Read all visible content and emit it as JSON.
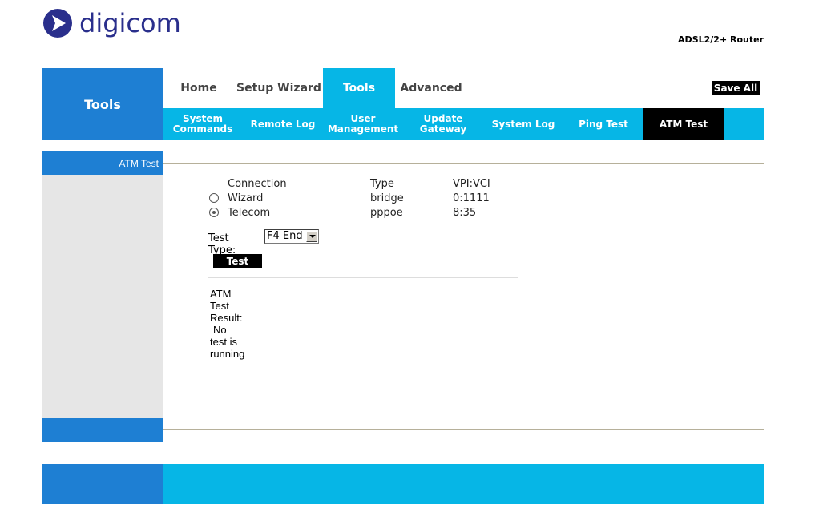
{
  "brand": {
    "name": "digicom",
    "product": "ADSL2/2+ Router",
    "logo_color": "#2a2f8c"
  },
  "section_title": "Tools",
  "top_nav": [
    {
      "label": "Home",
      "active": false
    },
    {
      "label": "Setup Wizard",
      "active": false
    },
    {
      "label": "Tools",
      "active": true
    },
    {
      "label": "Advanced",
      "active": false
    }
  ],
  "save_all_label": "Save All",
  "sub_nav": [
    {
      "label": "System Commands",
      "active": false
    },
    {
      "label": "Remote Log",
      "active": false
    },
    {
      "label": "User Management",
      "active": false
    },
    {
      "label": "Update Gateway",
      "active": false
    },
    {
      "label": "System Log",
      "active": false
    },
    {
      "label": "Ping Test",
      "active": false
    },
    {
      "label": "ATM Test",
      "active": true
    }
  ],
  "sidebar": {
    "title": "ATM Test"
  },
  "table": {
    "headers": {
      "connection": "Connection",
      "type": "Type",
      "vpivci": "VPI:VCI"
    },
    "rows": [
      {
        "connection": "Wizard",
        "type": "bridge",
        "vpivci": "0:1111",
        "selected": false
      },
      {
        "connection": "Telecom",
        "type": "pppoe",
        "vpivci": "8:35",
        "selected": true
      }
    ]
  },
  "test_type": {
    "label": "Test Type:",
    "value": "F4 End"
  },
  "test_button": "Test",
  "result": {
    "label": "ATM Test Result:",
    "value": "No test is running"
  },
  "colors": {
    "blue": "#1e7fd3",
    "cyan": "#06b6e6",
    "black": "#000000"
  }
}
